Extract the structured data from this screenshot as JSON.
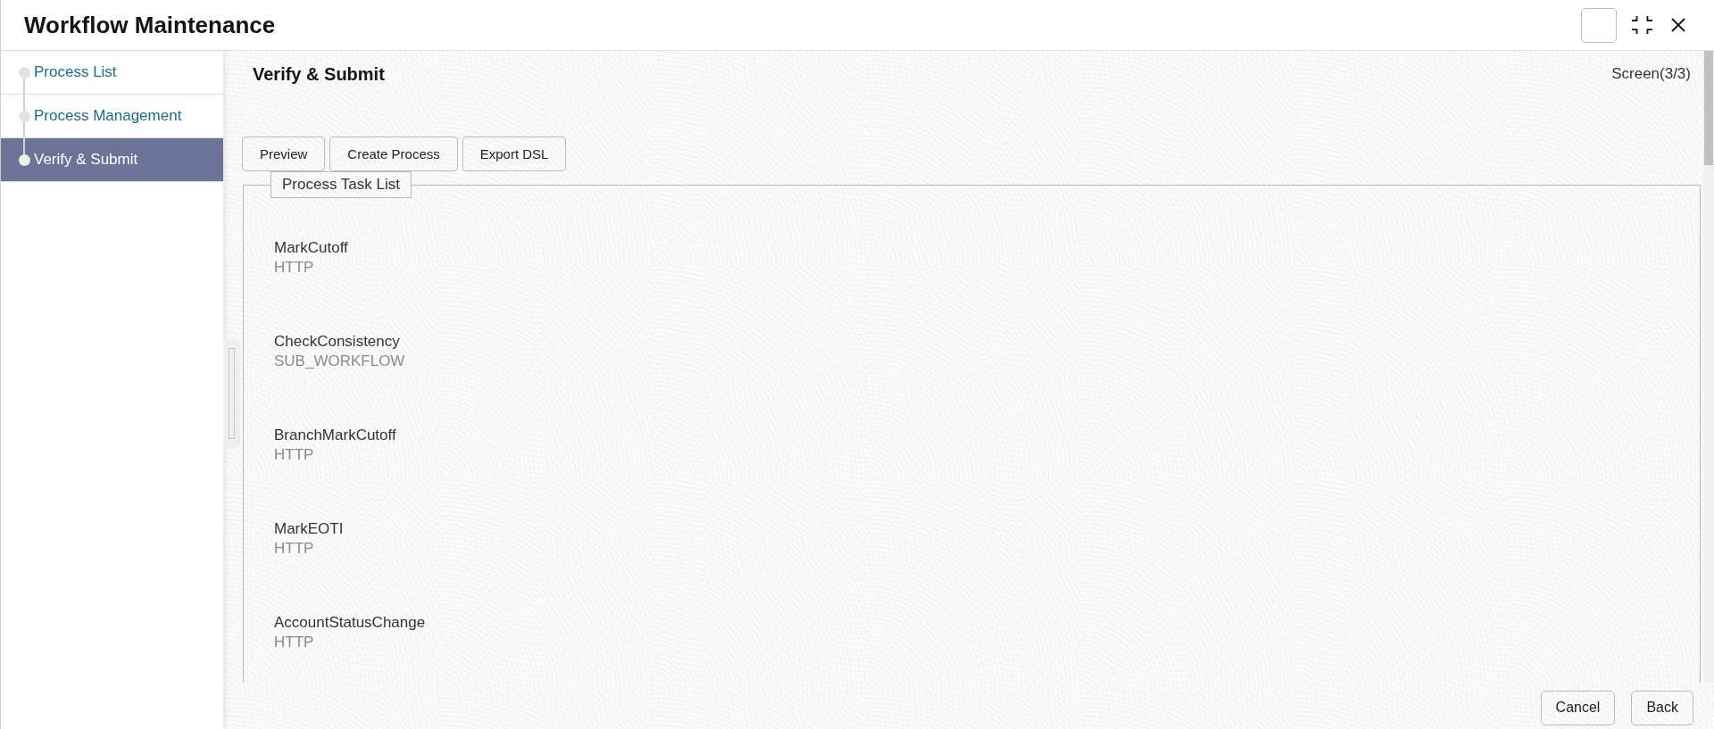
{
  "window": {
    "title": "Workflow Maintenance"
  },
  "sidebar": {
    "items": [
      {
        "label": "Process List",
        "selected": false
      },
      {
        "label": "Process Management",
        "selected": false
      },
      {
        "label": "Verify & Submit",
        "selected": true
      }
    ]
  },
  "page": {
    "heading": "Verify & Submit",
    "screen_indicator": "Screen(3/3)"
  },
  "toolbar": {
    "buttons": [
      "Preview",
      "Create Process",
      "Export DSL"
    ]
  },
  "task_list": {
    "legend": "Process Task List",
    "tasks": [
      {
        "name": "MarkCutoff",
        "type": "HTTP"
      },
      {
        "name": "CheckConsistency",
        "type": "SUB_WORKFLOW"
      },
      {
        "name": "BranchMarkCutoff",
        "type": "HTTP"
      },
      {
        "name": "MarkEOTI",
        "type": "HTTP"
      },
      {
        "name": "AccountStatusChange",
        "type": "HTTP"
      }
    ]
  },
  "footer": {
    "buttons": [
      "Cancel",
      "Back"
    ]
  }
}
